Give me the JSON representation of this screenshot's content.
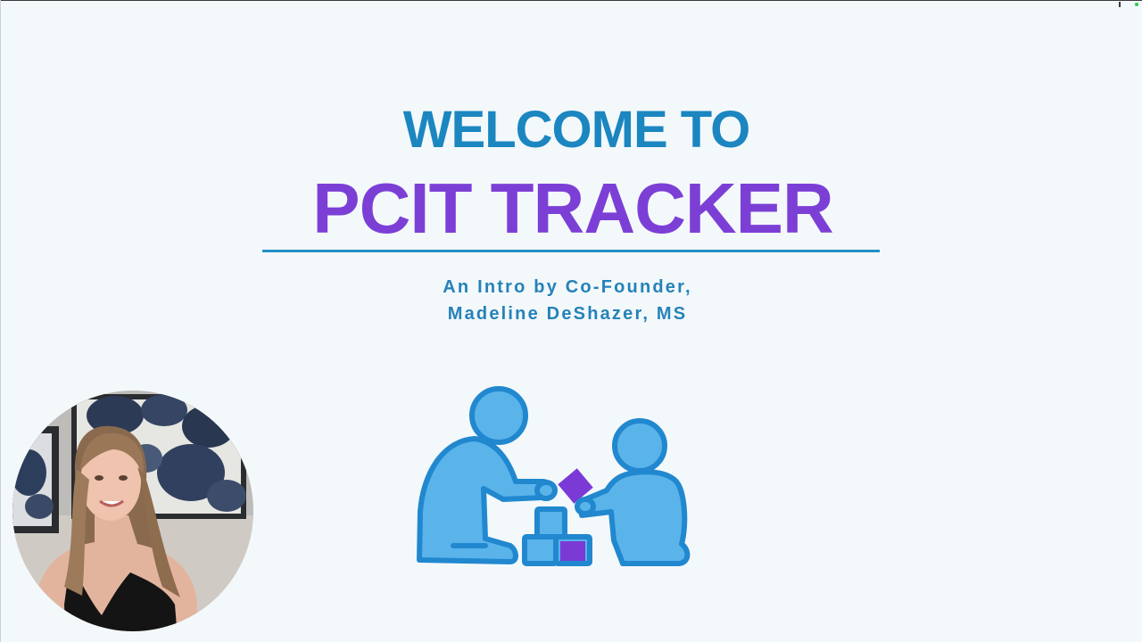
{
  "slide": {
    "heading_line1": "WELCOME TO",
    "heading_line2": "PCIT TRACKER",
    "subtitle_line1": "An Intro by Co-Founder,",
    "subtitle_line2": "Madeline DeShazer, MS"
  },
  "illustration": {
    "icon": "adult-child-playing-blocks-icon",
    "primary_color": "#5ab4ea",
    "outline_color": "#2188cf",
    "accent_color": "#7b3ad6"
  },
  "webcam": {
    "icon": "presenter-video-feed"
  },
  "colors": {
    "heading_blue": "#1b86c0",
    "heading_purple": "#7c3fd6",
    "subtitle_blue": "#2582b9",
    "background": "#f3f8fb"
  }
}
